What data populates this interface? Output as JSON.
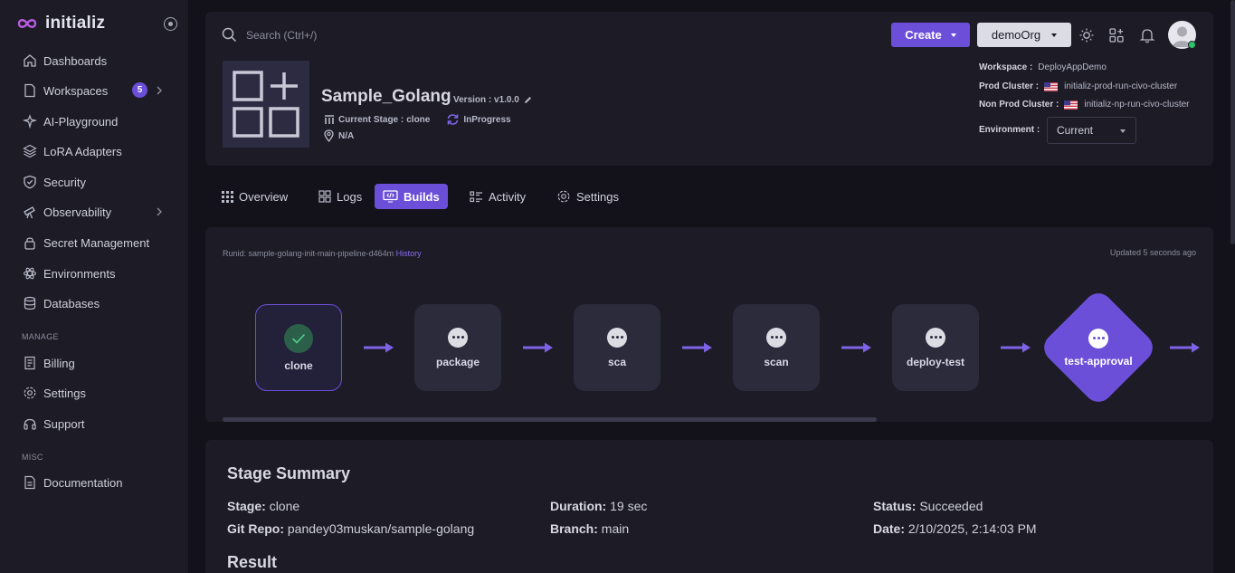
{
  "app": {
    "brand": "initializ"
  },
  "sidebar": {
    "items": [
      {
        "label": "Dashboards",
        "icon": "dashboard-icon"
      },
      {
        "label": "Workspaces",
        "icon": "file-icon",
        "badge": "5",
        "has_children": true
      },
      {
        "label": "AI-Playground",
        "icon": "bot-icon"
      },
      {
        "label": "LoRA Adapters",
        "icon": "layers-icon"
      },
      {
        "label": "Security",
        "icon": "shield-icon"
      },
      {
        "label": "Observability",
        "icon": "telescope-icon",
        "has_children": true
      },
      {
        "label": "Secret Management",
        "icon": "lock-icon"
      },
      {
        "label": "Environments",
        "icon": "atom-icon"
      },
      {
        "label": "Databases",
        "icon": "database-icon"
      }
    ],
    "manage_label": "MANAGE",
    "manage_items": [
      {
        "label": "Billing",
        "icon": "receipt-icon"
      },
      {
        "label": "Settings",
        "icon": "gear-icon"
      },
      {
        "label": "Support",
        "icon": "headset-icon"
      }
    ],
    "misc_label": "MISC",
    "misc_items": [
      {
        "label": "Documentation",
        "icon": "document-icon"
      }
    ]
  },
  "header": {
    "search_placeholder": "Search (Ctrl+/)",
    "create_label": "Create",
    "org_label": "demoOrg"
  },
  "application": {
    "name": "Sample_Golang",
    "version": "Version : v1.0.0",
    "current_stage_label": "Current Stage :",
    "current_stage_value": "clone",
    "status": "InProgress",
    "location": "N/A",
    "workspace_label": "Workspace :",
    "workspace_value": "DeployAppDemo",
    "prod_cluster_label": "Prod Cluster :",
    "prod_cluster_value": "initializ-prod-run-civo-cluster",
    "nonprod_cluster_label": "Non Prod Cluster :",
    "nonprod_cluster_value": "initializ-np-run-civo-cluster",
    "environment_label": "Environment :",
    "environment_value": "Current"
  },
  "tabs": [
    {
      "label": "Overview",
      "icon": "grid-icon"
    },
    {
      "label": "Logs",
      "icon": "apps-icon"
    },
    {
      "label": "Builds",
      "icon": "code-monitor-icon",
      "active": true
    },
    {
      "label": "Activity",
      "icon": "list-icon"
    },
    {
      "label": "Settings",
      "icon": "gear-icon"
    }
  ],
  "pipeline": {
    "runid_text": "Runid: sample-golang-init-main-pipeline-d464m",
    "history_label": "History",
    "updated_text": "Updated 5 seconds ago",
    "stages": [
      {
        "label": "clone",
        "state": "succeeded"
      },
      {
        "label": "package",
        "state": "pending"
      },
      {
        "label": "sca",
        "state": "pending"
      },
      {
        "label": "scan",
        "state": "pending"
      },
      {
        "label": "deploy-test",
        "state": "pending"
      },
      {
        "label": "test-approval",
        "state": "approval"
      }
    ]
  },
  "summary": {
    "title": "Stage Summary",
    "stage_label": "Stage:",
    "stage_value": "clone",
    "duration_label": "Duration:",
    "duration_value": "19 sec",
    "status_label": "Status:",
    "status_value": "Succeeded",
    "repo_label": "Git Repo:",
    "repo_value": "pandey03muskan/sample-golang",
    "branch_label": "Branch:",
    "branch_value": "main",
    "date_label": "Date:",
    "date_value": "2/10/2025, 2:14:03 PM",
    "result_title": "Result"
  },
  "colors": {
    "accent": "#6c4fd8",
    "success": "#2ec46a",
    "panel": "#1c1b26",
    "background": "#13121a"
  }
}
